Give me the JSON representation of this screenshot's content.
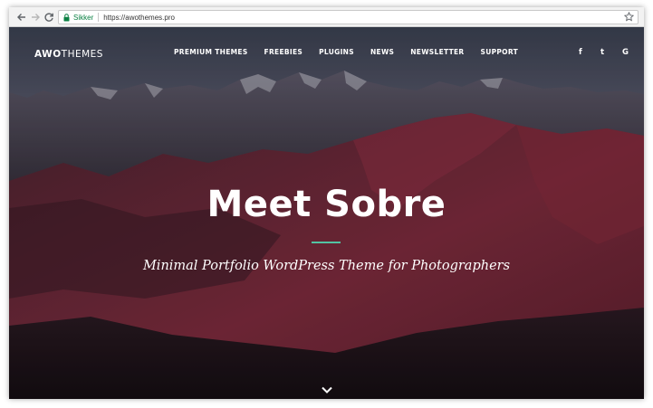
{
  "browser": {
    "secure_label": "Sikker",
    "url": "https://awothemes.pro",
    "icons": [
      "back-arrow-icon",
      "forward-arrow-icon",
      "reload-icon",
      "lock-icon",
      "bookmark-star-icon"
    ]
  },
  "site": {
    "brand_bold": "AWO",
    "brand_regular": "THEMES",
    "nav": [
      "PREMIUM THEMES",
      "FREEBIES",
      "PLUGINS",
      "NEWS",
      "NEWSLETTER",
      "SUPPORT"
    ],
    "social": [
      {
        "label": "f",
        "icon": "facebook-icon"
      },
      {
        "label": "t",
        "icon": "twitter-icon"
      },
      {
        "label": "G",
        "icon": "google-icon"
      }
    ]
  },
  "hero": {
    "title": "Meet Sobre",
    "subtitle": "Minimal Portfolio WordPress Theme for Photographers",
    "scroll_icon": "chevron-down-icon",
    "accent_color": "#52c3a2"
  },
  "colors": {
    "secure_green": "#0b8043",
    "sky": "#4d5161",
    "mountain_red": "#7a2536"
  }
}
